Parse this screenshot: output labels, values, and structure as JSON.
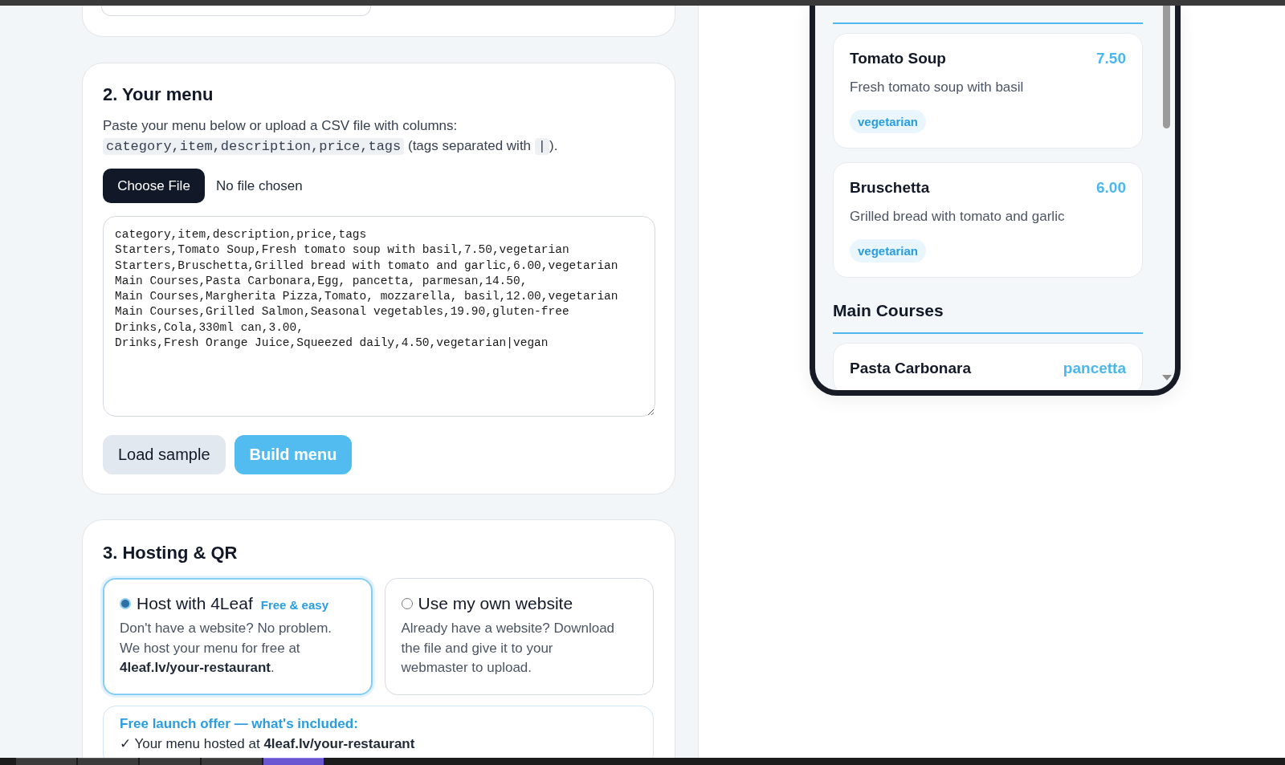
{
  "menu_section": {
    "title": "2. Your menu",
    "instructions": [
      {
        "kind": "text",
        "text": "Paste your menu below or upload a CSV file with columns: "
      },
      {
        "kind": "code",
        "text": "category,item,description,price,tags"
      },
      {
        "kind": "text",
        "text": " (tags separated with "
      },
      {
        "kind": "code",
        "text": "|"
      },
      {
        "kind": "text",
        "text": ")."
      }
    ],
    "file_input": {
      "button": "Choose File",
      "status": "No file chosen"
    },
    "csv_text": "category,item,description,price,tags\nStarters,Tomato Soup,Fresh tomato soup with basil,7.50,vegetarian\nStarters,Bruschetta,Grilled bread with tomato and garlic,6.00,vegetarian\nMain Courses,Pasta Carbonara,Egg, pancetta, parmesan,14.50,\nMain Courses,Margherita Pizza,Tomato, mozzarella, basil,12.00,vegetarian\nMain Courses,Grilled Salmon,Seasonal vegetables,19.90,gluten-free\nDrinks,Cola,330ml can,3.00,\nDrinks,Fresh Orange Juice,Squeezed daily,4.50,vegetarian|vegan",
    "buttons": [
      {
        "kind": "secondary",
        "label": "Load sample"
      },
      {
        "kind": "primary",
        "label": "Build menu"
      }
    ]
  },
  "hosting_section": {
    "title": "3. Hosting & QR",
    "options": [
      {
        "title": "Host with 4Leaf",
        "badge": "Free & easy",
        "description": "Don't have a website? No problem. We host your menu for free at **4leaf.lv/your-restaurant**.",
        "selected": true
      },
      {
        "title": "Use my own website",
        "description": "Already have a website? Download the file and give it to your webmaster to upload.",
        "selected": false
      }
    ],
    "offer": {
      "title": "Free launch offer — what's included:",
      "items": [
        "✓ Your menu hosted at **4leaf.lv/your-restaurant**"
      ]
    }
  },
  "preview": {
    "sections": [
      {
        "items": [
          {
            "name": "Tomato Soup",
            "price": "7.50",
            "description": "Fresh tomato soup with basil",
            "tags": [
              "vegetarian"
            ]
          },
          {
            "name": "Bruschetta",
            "price": "6.00",
            "description": "Grilled bread with tomato and garlic",
            "tags": [
              "vegetarian"
            ]
          }
        ]
      },
      {
        "heading": "Main Courses",
        "items": [
          {
            "name": "Pasta Carbonara",
            "price": "pancetta"
          }
        ]
      }
    ]
  },
  "taskbar": {
    "tabs": [
      {
        "selected": false
      },
      {
        "selected": false
      },
      {
        "selected": false
      },
      {
        "selected": false
      },
      {
        "selected": true
      }
    ]
  }
}
